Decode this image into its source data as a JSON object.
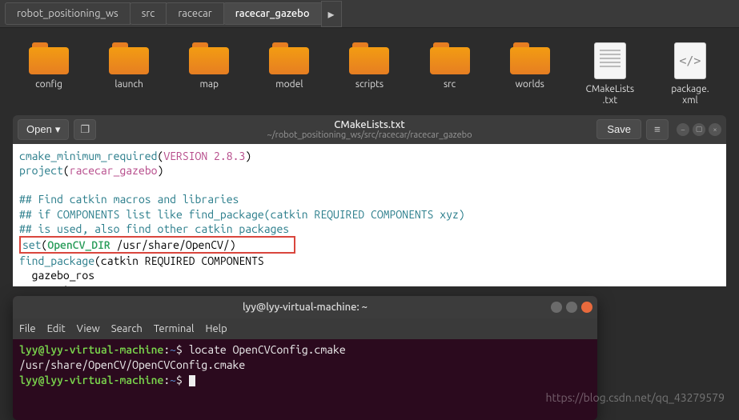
{
  "breadcrumb": [
    "robot_positioning_ws",
    "src",
    "racecar",
    "racecar_gazebo"
  ],
  "files": {
    "folders": [
      "config",
      "launch",
      "map",
      "model",
      "scripts",
      "src",
      "worlds"
    ],
    "text_file": "CMakeLists\n.txt",
    "xml_file": "package.\nxml",
    "xml_glyph": "</>"
  },
  "editor": {
    "open": "Open",
    "save": "Save",
    "title": "CMakeLists.txt",
    "path": "~/robot_positioning_ws/src/racecar/racecar_gazebo",
    "code": {
      "l1a": "cmake_minimum_required",
      "l1b": "(",
      "l1c": "VERSION 2.8.3",
      "l1d": ")",
      "l2a": "project",
      "l2b": "(",
      "l2c": "racecar_gazebo",
      "l2d": ")",
      "l3": "## Find catkin macros and libraries",
      "l4": "## if COMPONENTS list like find_package(catkin REQUIRED COMPONENTS xyz)",
      "l5": "## is used, also find other catkin packages",
      "l6a": "set",
      "l6b": "(",
      "l6c": "OpenCV_DIR",
      "l6d": " /usr/share/OpenCV/",
      "l6e": ")",
      "l7a": "find_package",
      "l7b": "(catkin REQUIRED COMPONENTS",
      "l8": "  gazebo_ros",
      "l9": "  geometry_msgs"
    }
  },
  "terminal": {
    "title": "lyy@lyy-virtual-machine: ~",
    "menu": [
      "File",
      "Edit",
      "View",
      "Search",
      "Terminal",
      "Help"
    ],
    "prompt": "lyy@lyy-virtual-machine",
    "colon": ":",
    "tilde": "~",
    "dollar": "$ ",
    "cmd1": "locate OpenCVConfig.cmake",
    "out1": "/usr/share/OpenCV/OpenCVConfig.cmake"
  },
  "watermark": "https://blog.csdn.net/qq_43279579"
}
